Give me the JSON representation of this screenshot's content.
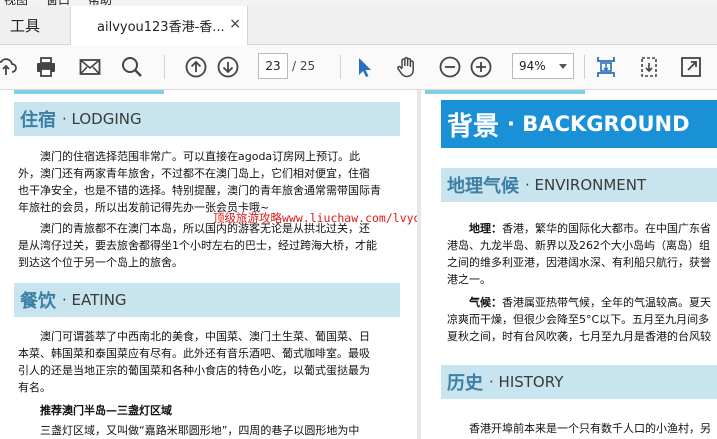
{
  "menubar": {
    "items": [
      "视图",
      "窗口",
      "帮助"
    ]
  },
  "tabs": {
    "tools": "工具",
    "document": "ailvyou123香港-香...",
    "close": "×"
  },
  "toolbar": {
    "page_current": "23",
    "page_total": "/ 25",
    "zoom": "94%"
  },
  "left_page": {
    "lodging": {
      "title_zh": "住宿",
      "title_en": "· LODGING",
      "p1": [
        "澳门的住宿选择范围非常广。可以直接在agoda订房网上预订。此",
        "外，澳门还有两家青年旅舍，不过都不在澳门岛上，它们相对便宜，住宿",
        "也干净安全，也是不错的选择。特别提醒，澳门的青年旅舍通常需带国际青",
        "年旅社的会员，所以出发前记得先办一张会员卡哦~"
      ],
      "p2": [
        "澳门的青旅都不在澳门本岛，所以国内的游客无论是从拱北过关，还",
        "是从湾仔过关，要去旅舍都得坐1个小时左右的巴士，经过跨海大桥，才能",
        "到达这个位于另一个岛上的旅舍。"
      ]
    },
    "dining": {
      "title_zh": "餐饮",
      "title_en": "· EATING",
      "p1": [
        "澳门可谓荟萃了中西南北的美食，中国菜、澳门土生菜、葡国菜、日",
        "本菜、韩国菜和泰国菜应有尽有。此外还有音乐酒吧、葡式咖啡室。最吸",
        "引人的还是当地正宗的葡国菜和各种小食店的特色小吃，以葡式蛋挞最为",
        "有名。"
      ],
      "subtitle": "推荐澳门半岛—三盏灯区域",
      "p2": "三盏灯区域，又叫做“嘉路米耶圆形地”，四周的巷子以圆形地为中"
    },
    "watermark": "顶级旅游攻略www.liuchaw.com/lvyou/ailvyou"
  },
  "right_page": {
    "background": {
      "title_zh": "背景",
      "title_en": "· BACKGROUND"
    },
    "environment": {
      "title_zh": "地理气候",
      "title_en": "· ENVIRONMENT",
      "p1_label": "地理：",
      "p1": [
        "香港，繁华的国际化大都市。在中国广东省",
        "港岛、九龙半岛、新界以及262个大小岛屿（离岛）组",
        "之间的维多利亚港，因港阔水深、有利船只航行，获誉",
        "港之一。"
      ],
      "p2_label": "气候：",
      "p2": [
        "香港属亚热带气候，全年的气温较高。夏天",
        "凉爽而干燥，但很少会降至5°C以下。五月至九月间多",
        "夏秋之间，时有台风吹袭，七月至九月是香港的台风较"
      ]
    },
    "history": {
      "title_zh": "历史",
      "title_en": "· HISTORY",
      "p1": "香港开埠前本来是一个只有数千人口的小渔村，另"
    }
  },
  "colors": {
    "header_band": "#c8e4ef",
    "accent_blue": "#1a91d6",
    "watermark_red": "#e01818"
  }
}
